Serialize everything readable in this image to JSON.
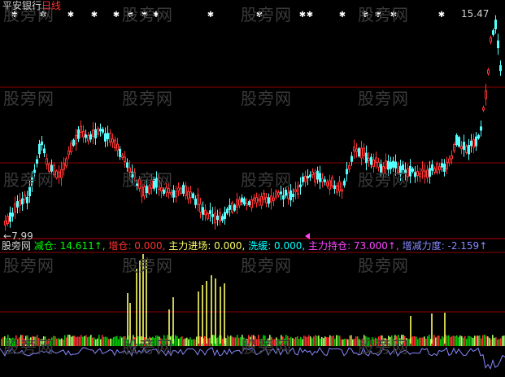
{
  "header": {
    "stock_name": "平安银行",
    "period": "日线"
  },
  "price_labels": {
    "high": "15.47",
    "low": "7.99"
  },
  "indicator": {
    "source": "股旁网",
    "items": [
      {
        "label": "减仓",
        "value": "14.611",
        "arrow": "↑",
        "color": "#00ff00"
      },
      {
        "label": "增仓",
        "value": "0.000",
        "arrow": "",
        "color": "#ff3030"
      },
      {
        "label": "主力进场",
        "value": "0.000",
        "arrow": "",
        "color": "#ffff66"
      },
      {
        "label": "洗缓",
        "value": "0.000",
        "arrow": "",
        "color": "#00ffff"
      },
      {
        "label": "主力持仓",
        "value": "73.000",
        "arrow": "↑",
        "color": "#ff44ff"
      },
      {
        "label": "增减力度",
        "value": "-2.159",
        "arrow": "↑",
        "color": "#8888ff"
      }
    ]
  },
  "watermark": "股旁网",
  "colors": {
    "up": "#ff3232",
    "down": "#54ffff",
    "reference_line": "#8b0000",
    "separator": "#c00000",
    "star": "#ffffff"
  }
}
